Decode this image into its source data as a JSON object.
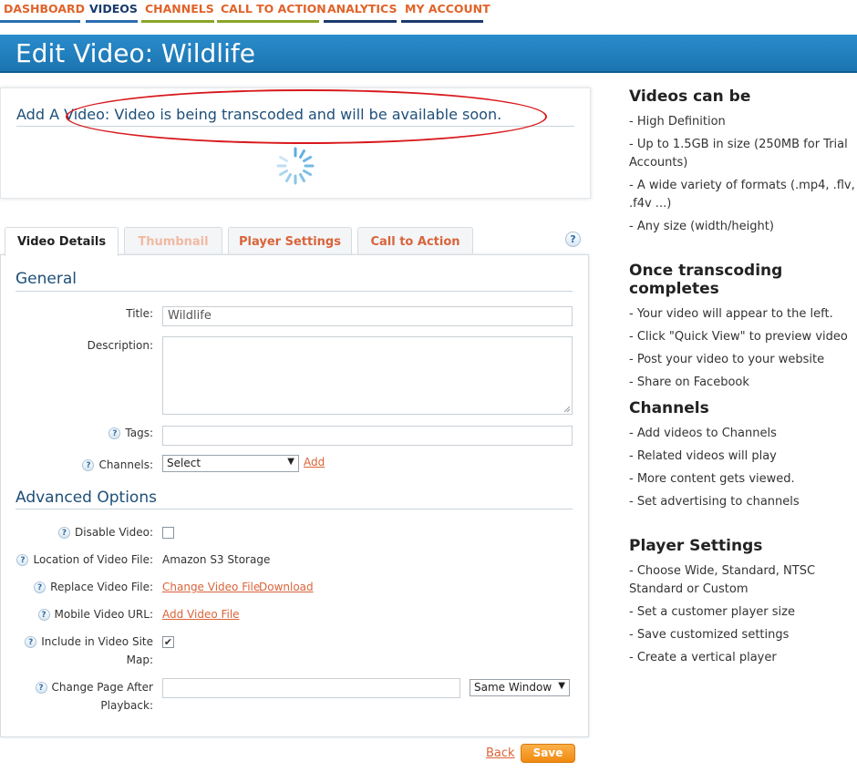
{
  "nav": {
    "tabs": [
      {
        "label": "DASHBOARD",
        "color": "#2a6db0"
      },
      {
        "label": "VIDEOS",
        "color": "#2a6db0"
      },
      {
        "label": "CHANNELS",
        "color": "#8aa62a"
      },
      {
        "label": "CALL TO ACTION",
        "color": "#8aa62a"
      },
      {
        "label": "ANALYTICS",
        "color": "#1a3a6b"
      },
      {
        "label": "MY ACCOUNT",
        "color": "#1a3a6b"
      }
    ]
  },
  "header": {
    "title": "Edit Video: Wildlife"
  },
  "notice": {
    "message": "Add A Video: Video is being transcoded and will be available soon."
  },
  "tabs": [
    "Video Details",
    "Thumbnail",
    "Player Settings",
    "Call to Action"
  ],
  "help_icon_text": "?",
  "general": {
    "title": "General",
    "title_label": "Title:",
    "title_value": "Wildlife",
    "description_label": "Description:",
    "tags_label": "Tags:",
    "channels_label": "Channels:",
    "channels_value": "Select",
    "add_link": "Add"
  },
  "advanced": {
    "title": "Advanced Options",
    "disable_label": "Disable Video:",
    "location_label": "Location of Video File:",
    "location_value": "Amazon S3 Storage",
    "replace_label": "Replace Video File:",
    "change_link": "Change Video File",
    "download_link": "Download",
    "mobile_label": "Mobile Video URL:",
    "add_video_link": "Add Video File",
    "sitemap_label_1": "Include in Video Site",
    "sitemap_label_2": "Map:",
    "change_page_label_1": "Change Page After",
    "change_page_label_2": "Playback:",
    "window_value": "Same Window"
  },
  "footer": {
    "back": "Back",
    "save": "Save"
  },
  "sidebar": [
    {
      "title": "Videos can be",
      "items": [
        "- High Definition",
        "- Up to 1.5GB in size (250MB for Trial Accounts)",
        "- A wide variety of formats (.mp4, .flv, .f4v ...)",
        "- Any size (width/height)"
      ]
    },
    {
      "title": "Once transcoding completes",
      "items": [
        "- Your video will appear to the left.",
        "- Click \"Quick View\" to preview video",
        "- Post your video to your website",
        "- Share on Facebook"
      ]
    },
    {
      "title": "Channels",
      "items": [
        "- Add videos to Channels",
        "- Related videos will play",
        "- More content gets viewed.",
        "- Set advertising to channels"
      ]
    },
    {
      "title": "Player Settings",
      "items": [
        "- Choose Wide, Standard, NTSC Standard or Custom",
        "- Set a customer player size",
        "- Save customized settings",
        "- Create a vertical player"
      ]
    }
  ]
}
